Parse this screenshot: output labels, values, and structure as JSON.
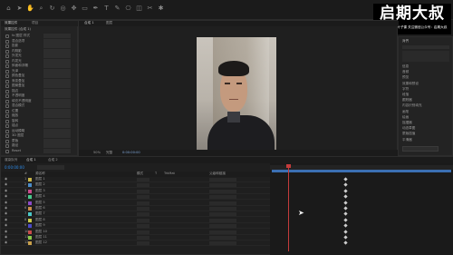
{
  "watermark": {
    "brand_text": "启期大叔",
    "subtitle": "更多教程搜索叶子课 关注微信公众号：启期大叔"
  },
  "colors": {
    "accent": "#2d8ceb",
    "playhead": "#c43b3b",
    "keyframe": "#cfcfcf",
    "work_area": "#3b6fb3"
  },
  "left_panel": {
    "tabs": [
      "效果控件",
      "项目"
    ],
    "header": "效果控件 (合成 1)",
    "effect_rows": [
      {
        "label": "fx 图层 样式"
      },
      {
        "label": "混合选项"
      },
      {
        "label": "投影"
      },
      {
        "label": "内阴影"
      },
      {
        "label": "外发光"
      },
      {
        "label": "内发光"
      },
      {
        "label": "斜面和浮雕"
      },
      {
        "label": "光泽"
      },
      {
        "label": "颜色叠加"
      },
      {
        "label": "渐变叠加"
      },
      {
        "label": "图案叠加"
      },
      {
        "label": "描边"
      },
      {
        "label": "不透明度"
      },
      {
        "label": "填充不透明度"
      },
      {
        "label": "混合模式"
      },
      {
        "label": "位置"
      },
      {
        "label": "缩放"
      },
      {
        "label": "旋转"
      },
      {
        "label": "锚点"
      },
      {
        "label": "运动模糊"
      },
      {
        "label": "3D 图层"
      },
      {
        "label": "蒙版"
      },
      {
        "label": "路径"
      },
      {
        "label": "Reset"
      }
    ]
  },
  "viewer": {
    "tabs": [
      "合成 1",
      "图层"
    ],
    "footer_items": [
      "50%",
      "完整",
      "0:00:00:00"
    ]
  },
  "right_panel": {
    "header": "对齐",
    "rows": [
      "信息",
      "音频",
      "预览",
      "效果和预设",
      "字符",
      "段落",
      "跟踪器",
      "内容识别填充",
      "画笔",
      "绘画",
      "摇摆器",
      "动态草图",
      "蒙版插值",
      "平滑器"
    ]
  },
  "timeline": {
    "tabs": [
      "渲染队列",
      "合成 1",
      "合成 2"
    ],
    "timecode": "0:00:00:00",
    "columns": [
      "#",
      "源名称",
      "模式",
      "T",
      "TrkMat",
      "父级和链接"
    ],
    "layers": [
      {
        "num": "1",
        "name": "图层 1"
      },
      {
        "num": "2",
        "name": "图层 2"
      },
      {
        "num": "3",
        "name": "图层 3"
      },
      {
        "num": "4",
        "name": "图层 4"
      },
      {
        "num": "5",
        "name": "图层 5"
      },
      {
        "num": "6",
        "name": "图层 6"
      },
      {
        "num": "7",
        "name": "图层 7"
      },
      {
        "num": "8",
        "name": "图层 8"
      },
      {
        "num": "9",
        "name": "图层 9"
      },
      {
        "num": "10",
        "name": "图层 10"
      },
      {
        "num": "11",
        "name": "图层 11"
      },
      {
        "num": "12",
        "name": "图层 12"
      }
    ]
  }
}
